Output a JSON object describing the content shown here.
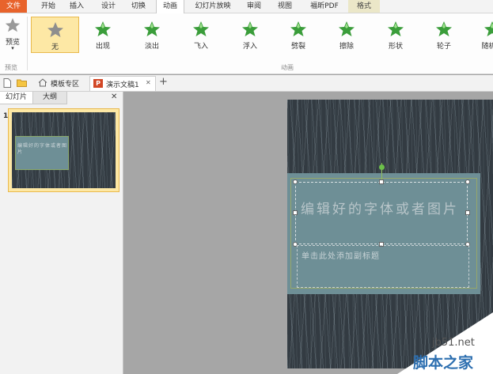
{
  "menu": {
    "items": [
      "文件",
      "开始",
      "插入",
      "设计",
      "切换",
      "动画",
      "幻灯片放映",
      "审阅",
      "视图",
      "福昕PDF",
      "格式"
    ]
  },
  "ribbon": {
    "preview_label": "预览",
    "preview_group_label": "预览",
    "animation_group_label": "动画",
    "animations": [
      "无",
      "出现",
      "淡出",
      "飞入",
      "浮入",
      "劈裂",
      "擦除",
      "形状",
      "轮子",
      "随机线"
    ]
  },
  "tabs": {
    "home_tab": "模板专区",
    "doc_tab": "演示文稿1",
    "close_glyph": "✕",
    "new_tab_glyph": "+"
  },
  "left_panel": {
    "tab_slides": "幻灯片",
    "tab_outline": "大纲",
    "close_glyph": "✕",
    "slide_number": "1",
    "thumb_title": "编辑好的字体或者图片"
  },
  "slide": {
    "title_text": "编辑好的字体或者图片",
    "subtitle_placeholder": "单击此处添加副标题"
  },
  "watermark": {
    "site": "jb51.net",
    "name": "脚本之家"
  },
  "colors": {
    "file_tab": "#e8632b",
    "selection": "#fde8a5",
    "title_box": "#6e8f96",
    "star_green": "#3a9d3a"
  }
}
